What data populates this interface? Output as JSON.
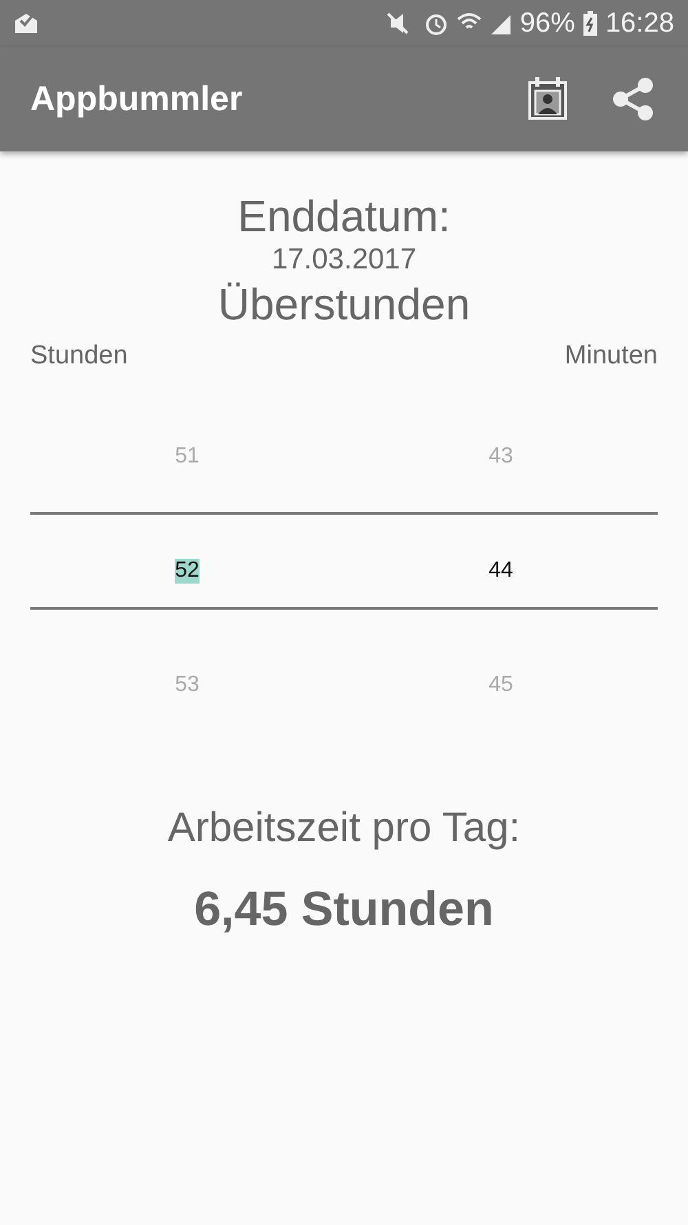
{
  "status_bar": {
    "battery": "96%",
    "time": "16:28"
  },
  "app_bar": {
    "title": "Appbummler"
  },
  "end_date": {
    "label": "Enddatum:",
    "value": "17.03.2017"
  },
  "overtime": {
    "title": "Überstunden",
    "column_labels": [
      "Stunden",
      "Minuten"
    ],
    "columns": [
      {
        "items": [
          {
            "text": "51",
            "selected": false,
            "highlighted": false
          },
          {
            "text": "52",
            "selected": true,
            "highlighted": true
          },
          {
            "text": "53",
            "selected": false,
            "highlighted": false
          }
        ]
      },
      {
        "items": [
          {
            "text": "43",
            "selected": false,
            "highlighted": false
          },
          {
            "text": "44",
            "selected": true,
            "highlighted": false
          },
          {
            "text": "45",
            "selected": false,
            "highlighted": false
          }
        ]
      }
    ]
  },
  "work_time": {
    "label": "Arbeitszeit pro Tag:",
    "value": "6,45 Stunden"
  }
}
